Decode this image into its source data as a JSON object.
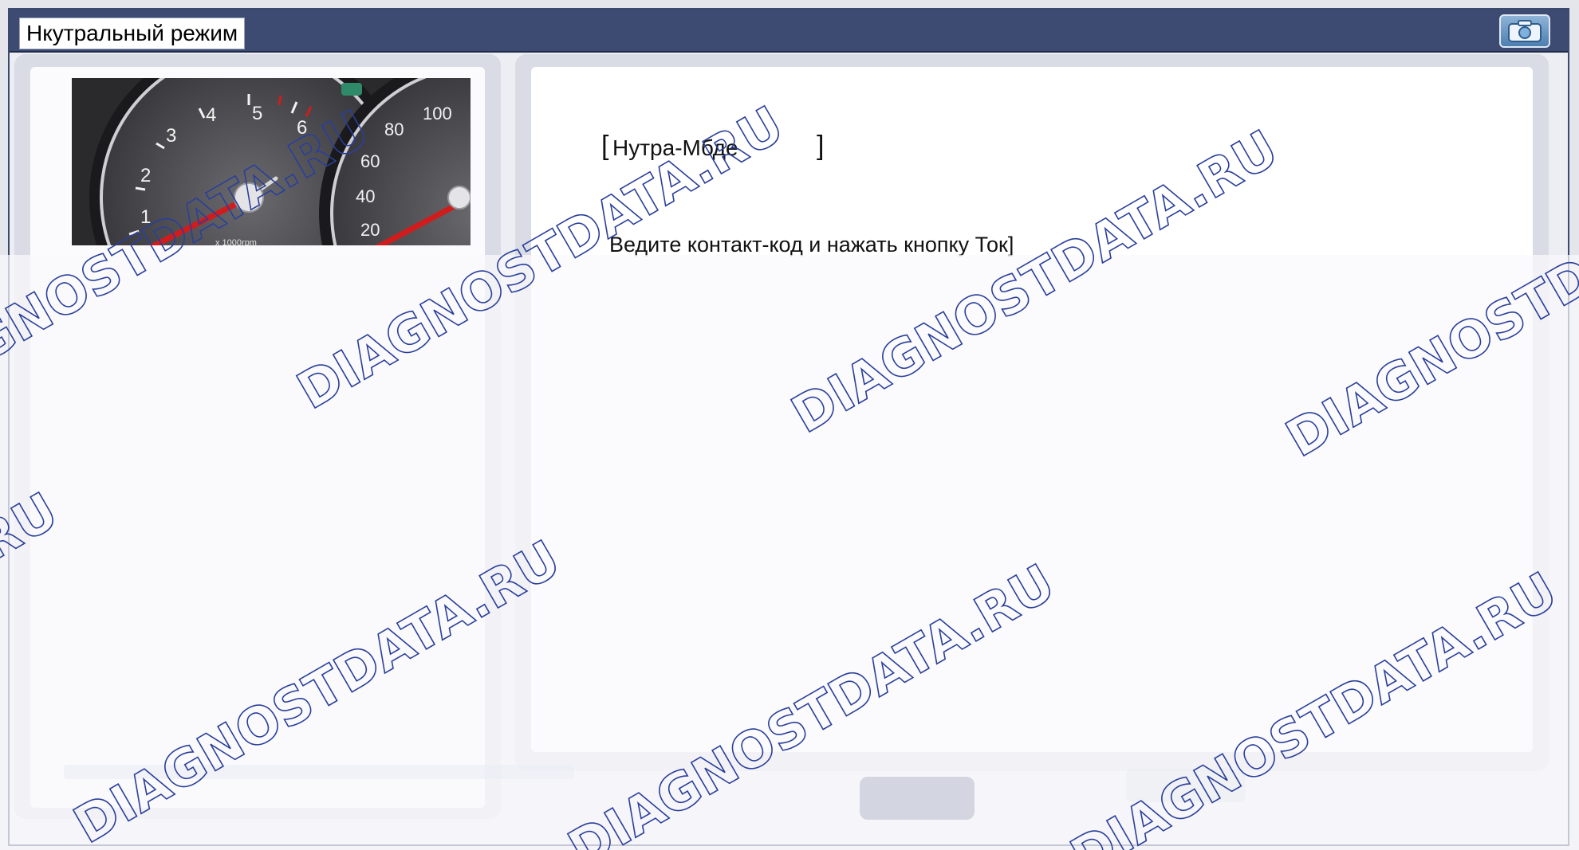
{
  "window": {
    "title": "Нкутральный режим"
  },
  "content": {
    "mode_label": "Нутра-Мбде",
    "instruction": "Ведите контакт-код и нажать кнопку Ток]"
  },
  "gauge": {
    "tach_ticks": [
      "1",
      "2",
      "3",
      "4",
      "5",
      "6"
    ],
    "tach_unit": "x 1000rpm",
    "speed_ticks": [
      "20",
      "40",
      "60",
      "80",
      "100"
    ]
  },
  "watermark": {
    "lines": [
      "DIAGNOSTDATA.RU"
    ]
  },
  "icons": {
    "camera": "camera-icon"
  },
  "colors": {
    "titlebar": "#3d4a72",
    "needle": "#d01c1c"
  }
}
